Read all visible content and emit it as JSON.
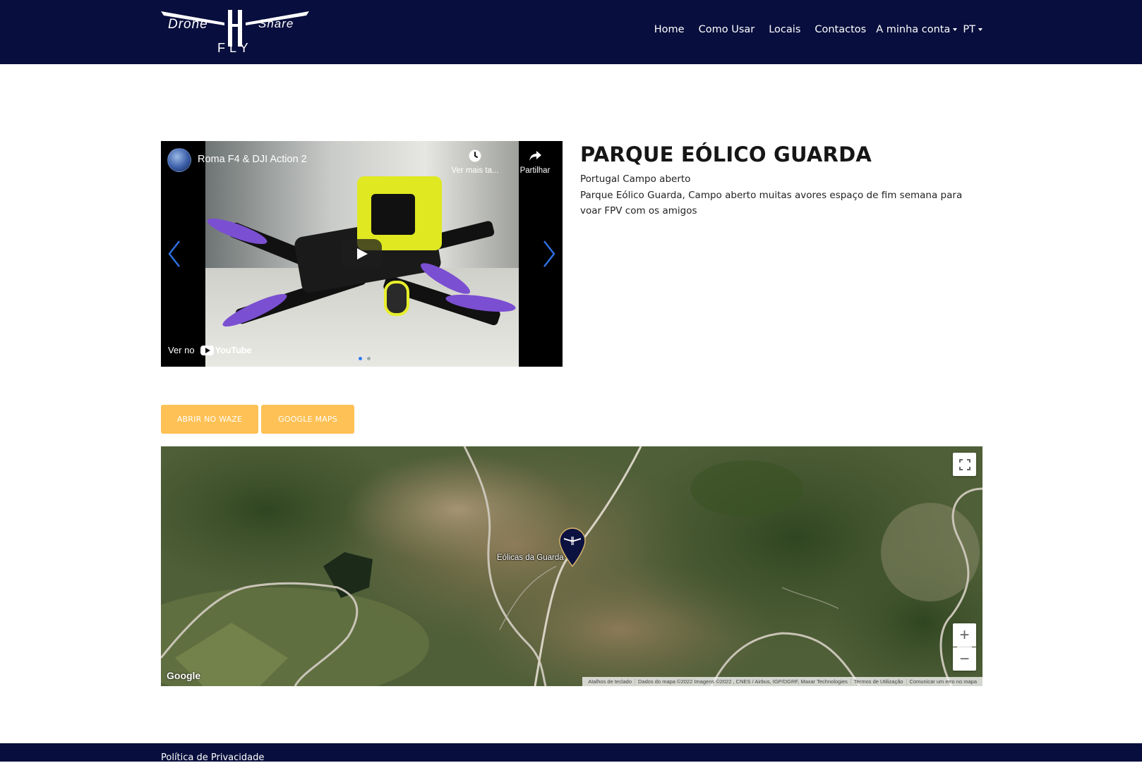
{
  "header": {
    "logo": {
      "word_left": "Drone",
      "word_right": "Share",
      "word_bottom": "FLY"
    },
    "nav": [
      {
        "label": "Home"
      },
      {
        "label": "Como Usar"
      },
      {
        "label": "Locais"
      },
      {
        "label": "Contactos"
      }
    ],
    "account_label": "A minha conta",
    "language_label": "PT",
    "background_color": "#080e3d"
  },
  "video": {
    "title": "Roma F4 & DJI Action 2",
    "watch_later_label": "Ver mais ta...",
    "share_label": "Partilhar",
    "watch_on_label": "Ver no",
    "youtube_label": "YouTube",
    "carousel_dots": 2,
    "active_dot": 0,
    "icons": [
      "channel-avatar",
      "clock-icon",
      "share-icon",
      "play-icon",
      "chevron-left-icon",
      "chevron-right-icon",
      "youtube-icon"
    ]
  },
  "location": {
    "title": "PARQUE EÓLICO GUARDA",
    "subtitle": "Portugal Campo aberto",
    "description": "Parque Eólico Guarda, Campo aberto muitas avores espaço de fim semana para voar FPV com os amigos"
  },
  "buttons": {
    "waze_label": "ABRIR NO WAZE",
    "google_maps_label": "GOOGLE MAPS",
    "color": "#fdc155"
  },
  "map": {
    "place_label": "Eólicas da Guarda",
    "google_label": "Google",
    "zoom_in_label": "+",
    "zoom_out_label": "−",
    "attribution": [
      "Atalhos de teclado",
      "Dados do mapa ©2022 Imagens ©2022 , CNES / Airbus, IGP/DGRF, Maxar Technologies",
      "Termos de Utilização",
      "Comunicar um erro no mapa"
    ]
  },
  "footer": {
    "privacy_label": "Política de Privacidade"
  }
}
